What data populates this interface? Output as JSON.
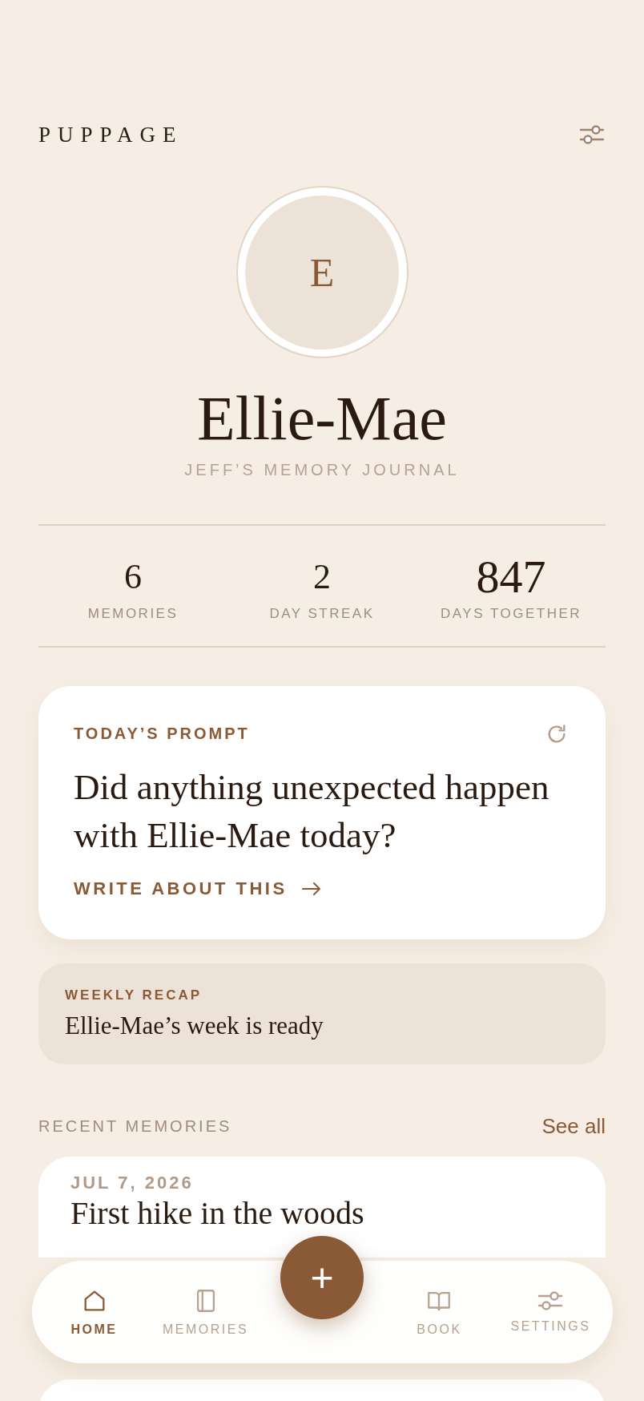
{
  "header": {
    "brand": "PUPPAGE"
  },
  "profile": {
    "initial": "E",
    "name": "Ellie-Mae",
    "subtitle": "JEFF’S MEMORY JOURNAL"
  },
  "stats": [
    {
      "value": "6",
      "label": "MEMORIES"
    },
    {
      "value": "2",
      "label": "DAY STREAK"
    },
    {
      "value": "847",
      "label": "DAYS TOGETHER"
    }
  ],
  "prompt": {
    "label": "TODAY’S PROMPT",
    "question": "Did anything unexpected happen with Ellie-Mae today?",
    "action": "WRITE ABOUT THIS"
  },
  "recap": {
    "label": "WEEKLY RECAP",
    "title": "Ellie-Mae’s week is ready"
  },
  "recent": {
    "heading": "RECENT MEMORIES",
    "link": "See all"
  },
  "memories": [
    {
      "date": "JUL 7, 2026",
      "title": "First hike in the woods"
    }
  ],
  "nav": [
    {
      "kind": "home",
      "label": "HOME",
      "selected": true
    },
    {
      "kind": "memories",
      "label": "MEMORIES",
      "selected": false
    },
    {
      "kind": "book",
      "label": "BOOK",
      "selected": false
    },
    {
      "kind": "settings",
      "label": "SETTINGS",
      "selected": false
    }
  ],
  "fab": {
    "symbol": "+"
  }
}
